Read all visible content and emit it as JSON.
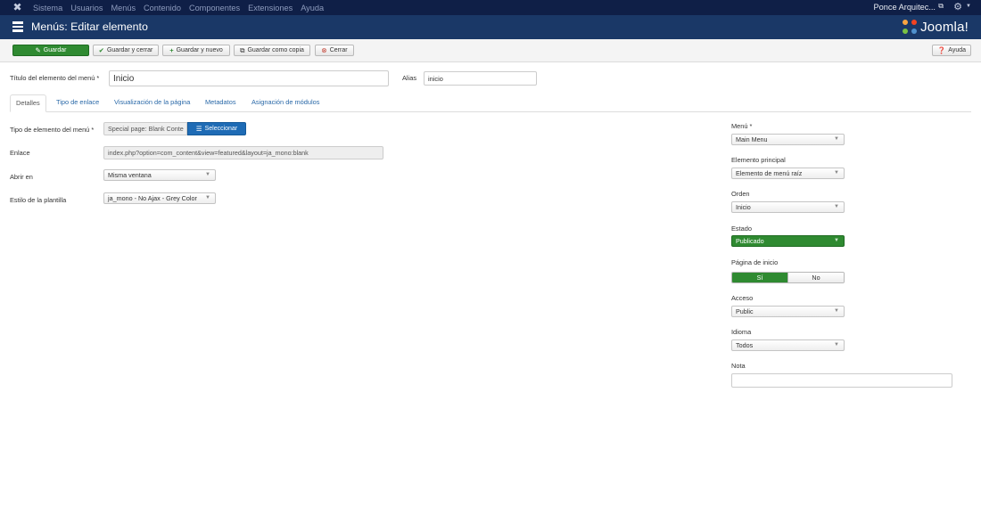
{
  "topbar": {
    "logo_icon": "joomla-icon",
    "nav": [
      "Sistema",
      "Usuarios",
      "Menús",
      "Contenido",
      "Componentes",
      "Extensiones",
      "Ayuda"
    ],
    "user": "Ponce Arquitec...",
    "user_icon": "external-link-icon",
    "settings_icon": "gear-icon"
  },
  "header": {
    "title": "Menús: Editar elemento",
    "title_icon": "list-icon",
    "brand": "Joomla!"
  },
  "toolbar": {
    "save": "Guardar",
    "save_close": "Guardar y cerrar",
    "save_new": "Guardar y nuevo",
    "save_copy": "Guardar como copia",
    "close": "Cerrar",
    "help": "Ayuda"
  },
  "form": {
    "title_label": "Título del elemento del menú *",
    "title_value": "Inicio",
    "alias_label": "Alias",
    "alias_value": "inicio"
  },
  "tabs": [
    "Detalles",
    "Tipo de enlace",
    "Visualización de la página",
    "Metadatos",
    "Asignación de módulos"
  ],
  "details": {
    "type_label": "Tipo de elemento del menú *",
    "type_value": "Special page: Blank Conte",
    "select_button": "Seleccionar",
    "link_label": "Enlace",
    "link_value": "index.php?option=com_content&view=featured&layout=ja_mono:blank",
    "target_label": "Abrir en",
    "target_value": "Misma ventana",
    "style_label": "Estilo de la plantilla",
    "style_value": "ja_mono - No Ajax - Grey Color"
  },
  "sidebar": {
    "menu_label": "Menú *",
    "menu_value": "Main Menu",
    "parent_label": "Elemento principal",
    "parent_value": "Elemento de menú raíz",
    "order_label": "Orden",
    "order_value": "Inicio",
    "status_label": "Estado",
    "status_value": "Publicado",
    "home_label": "Página de inicio",
    "home_yes": "Sí",
    "home_no": "No",
    "access_label": "Acceso",
    "access_value": "Public",
    "language_label": "Idioma",
    "language_value": "Todos",
    "note_label": "Nota",
    "note_value": ""
  },
  "colors": {
    "topbar": "#0f1f47",
    "header": "#1a3867",
    "green": "#2f8a31",
    "primary_blue": "#2a69a8"
  }
}
